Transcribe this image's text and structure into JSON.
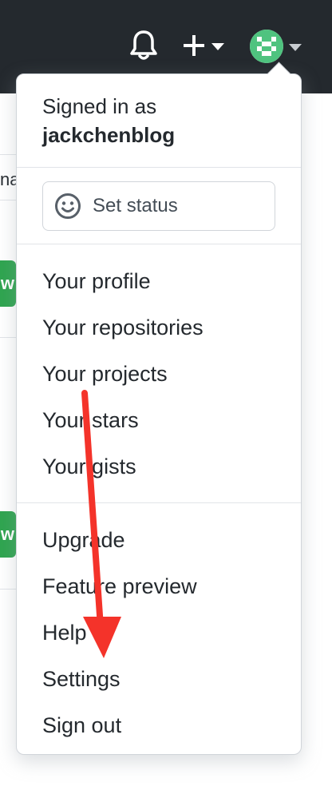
{
  "header": {
    "bell_icon": "bell-icon",
    "plus_icon": "plus-icon",
    "caret_icon": "caret-down-icon",
    "avatar_icon": "identicon-avatar",
    "background_color": "#24292e"
  },
  "background_page": {
    "truncated_text": "na",
    "green_button_text": "w",
    "green_color": "#2ea44f"
  },
  "dropdown": {
    "signed_in_label": "Signed in as",
    "username": "jackchenblog",
    "set_status_label": "Set status",
    "status_icon": "smiley-icon",
    "group1": [
      {
        "label": "Your profile"
      },
      {
        "label": "Your repositories"
      },
      {
        "label": "Your projects"
      },
      {
        "label": "Your stars"
      },
      {
        "label": "Your gists"
      }
    ],
    "group2": [
      {
        "label": "Upgrade"
      },
      {
        "label": "Feature preview"
      },
      {
        "label": "Help"
      },
      {
        "label": "Settings"
      },
      {
        "label": "Sign out"
      }
    ]
  },
  "annotation": {
    "arrow_color": "#f4332a",
    "arrow_target": "Settings"
  }
}
